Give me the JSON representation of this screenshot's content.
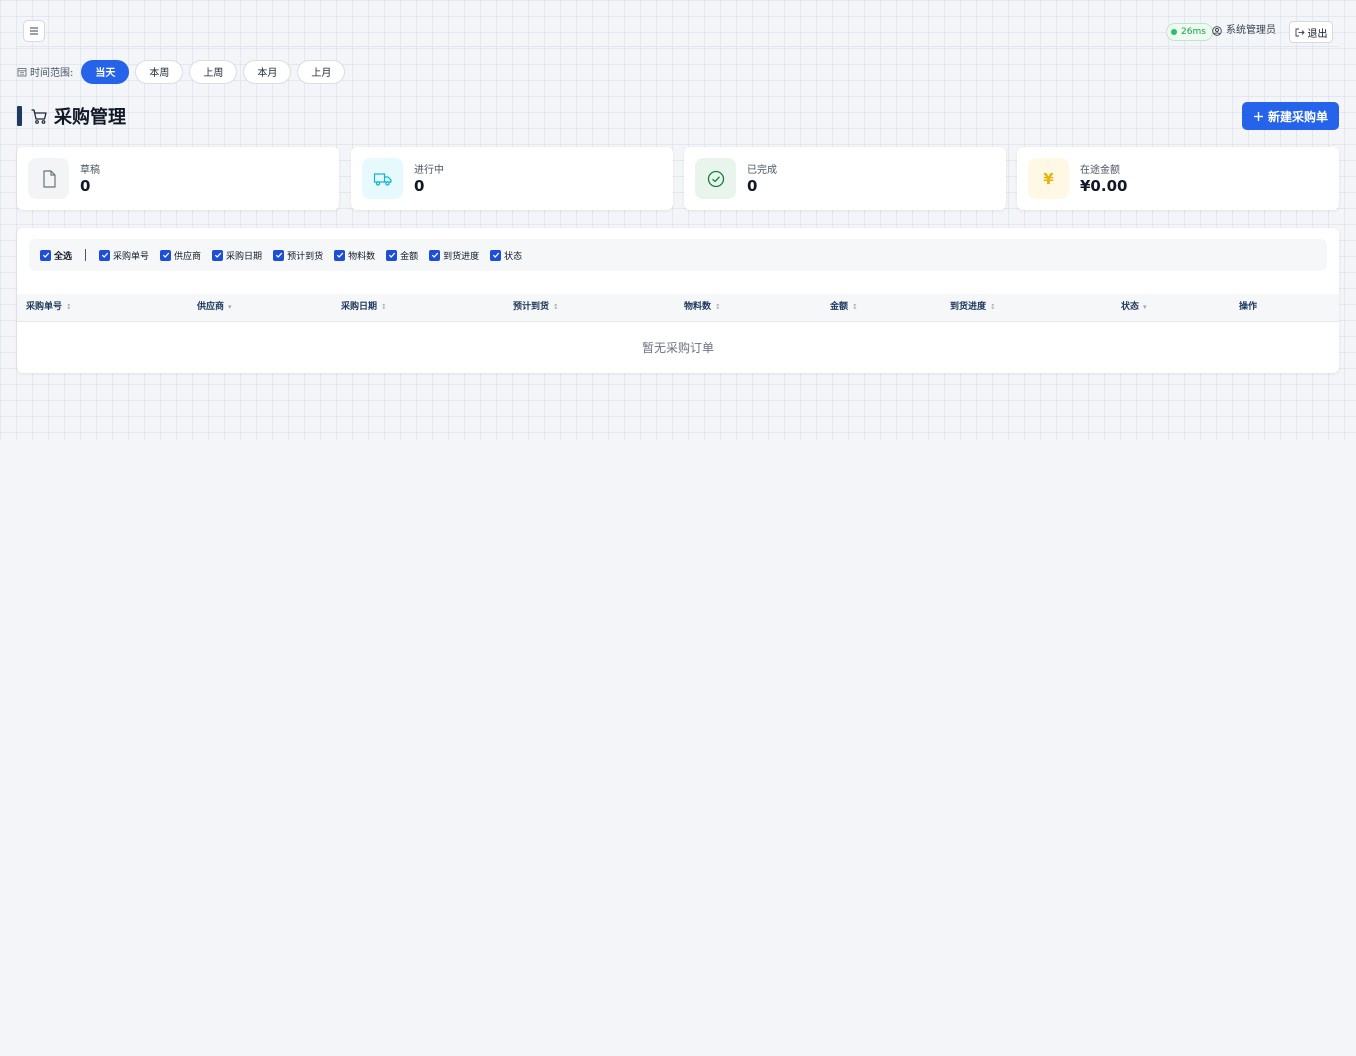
{
  "topbar": {
    "latency": "26ms",
    "user_name": "系统管理员",
    "logout_label": "退出"
  },
  "time_range": {
    "label": "时间范围:",
    "options": [
      "当天",
      "本周",
      "上周",
      "本月",
      "上月"
    ],
    "selected": "当天"
  },
  "page": {
    "title": "采购管理",
    "new_button_label": "新建采购单"
  },
  "stats": [
    {
      "label": "草稿",
      "value": "0",
      "icon": "file-icon",
      "color": "#6b7280"
    },
    {
      "label": "进行中",
      "value": "0",
      "icon": "truck-icon",
      "color": "#06b6d4"
    },
    {
      "label": "已完成",
      "value": "0",
      "icon": "check-circle-icon",
      "color": "#15803d"
    },
    {
      "label": "在途金额",
      "value": "¥0.00",
      "icon": "yen-icon",
      "color": "#eab308"
    }
  ],
  "column_toggles": {
    "select_all": "全选",
    "columns": [
      "采购单号",
      "供应商",
      "采购日期",
      "预计到货",
      "物料数",
      "金额",
      "到货进度",
      "状态"
    ]
  },
  "table": {
    "headers": [
      "采购单号",
      "供应商",
      "采购日期",
      "预计到货",
      "物料数",
      "金额",
      "到货进度",
      "状态",
      "操作"
    ],
    "empty_text": "暂无采购订单"
  },
  "colors": {
    "accent": "#2563eb",
    "background": "#f4f5f9"
  }
}
